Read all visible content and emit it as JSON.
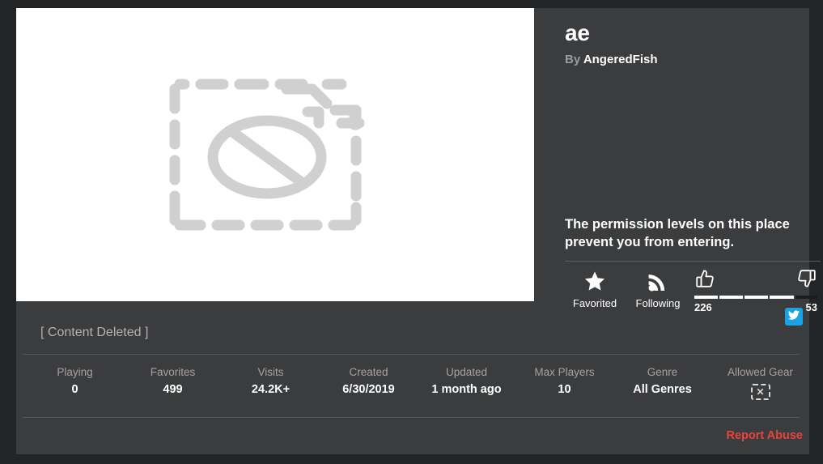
{
  "colors": {
    "page_background": "#232426",
    "card_background": "#3b3c3e",
    "accent_report": "#e8443c",
    "twitter_blue": "#1ca1e2",
    "placeholder_gray": "#d0d0d0",
    "label_gray": "#a9a1a1",
    "description_gray": "#b6b2b2"
  },
  "thumbnail": {
    "icon": "blocked-content-placeholder-icon",
    "alt": "Content blocked placeholder"
  },
  "header": {
    "title": "ae",
    "by_label": "By",
    "author": "AngeredFish"
  },
  "permission": {
    "message": "The permission levels on this place prevent you from entering."
  },
  "actions": {
    "favorite": {
      "icon": "star-icon",
      "label": "Favorited"
    },
    "follow": {
      "icon": "rss-following-icon",
      "label": "Following"
    },
    "votes": {
      "up_icon": "thumbs-up-icon",
      "down_icon": "thumbs-down-icon",
      "up_count": "226",
      "down_count": "53",
      "up_percent": 81
    },
    "share": {
      "icon": "twitter-icon",
      "label": "Share on Twitter"
    }
  },
  "description": {
    "text": "[ Content Deleted ]"
  },
  "stats": [
    {
      "label": "Playing",
      "value": "0"
    },
    {
      "label": "Favorites",
      "value": "499"
    },
    {
      "label": "Visits",
      "value": "24.2K+"
    },
    {
      "label": "Created",
      "value": "6/30/2019"
    },
    {
      "label": "Updated",
      "value": "1 month ago"
    },
    {
      "label": "Max Players",
      "value": "10"
    },
    {
      "label": "Genre",
      "value": "All Genres"
    },
    {
      "label": "Allowed Gear",
      "value": "",
      "icon": "broken-image-icon",
      "icon_glyph": "✕"
    }
  ],
  "footer": {
    "report_abuse": "Report Abuse"
  }
}
